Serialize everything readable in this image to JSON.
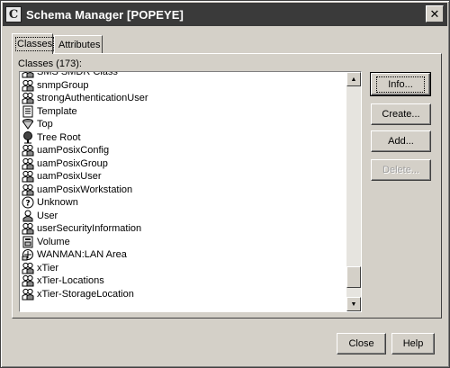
{
  "window": {
    "title": "Schema Manager [POPEYE]",
    "title_icon_glyph": "C",
    "close_glyph": "✕"
  },
  "tabs": [
    {
      "label": "Classes",
      "active": true
    },
    {
      "label": "Attributes",
      "active": false
    }
  ],
  "classes_list": {
    "caption": "Classes (173):",
    "items": [
      {
        "label": "SMS SMDR Class",
        "icon": "class-icon"
      },
      {
        "label": "snmpGroup",
        "icon": "class-icon"
      },
      {
        "label": "strongAuthenticationUser",
        "icon": "class-icon"
      },
      {
        "label": "Template",
        "icon": "template-icon"
      },
      {
        "label": "Top",
        "icon": "top-icon"
      },
      {
        "label": "Tree Root",
        "icon": "tree-root-icon"
      },
      {
        "label": "uamPosixConfig",
        "icon": "class-icon"
      },
      {
        "label": "uamPosixGroup",
        "icon": "class-icon"
      },
      {
        "label": "uamPosixUser",
        "icon": "class-icon"
      },
      {
        "label": "uamPosixWorkstation",
        "icon": "class-icon"
      },
      {
        "label": "Unknown",
        "icon": "unknown-icon"
      },
      {
        "label": "User",
        "icon": "user-icon"
      },
      {
        "label": "userSecurityInformation",
        "icon": "class-icon"
      },
      {
        "label": "Volume",
        "icon": "volume-icon"
      },
      {
        "label": "WANMAN:LAN Area",
        "icon": "lan-area-icon"
      },
      {
        "label": "xTier",
        "icon": "class-icon"
      },
      {
        "label": "xTier-Locations",
        "icon": "class-icon"
      },
      {
        "label": "xTier-StorageLocation",
        "icon": "class-icon"
      }
    ],
    "scroll_position": 0.95,
    "scroll_up_glyph": "▲",
    "scroll_down_glyph": "▼"
  },
  "actions": {
    "info": "Info...",
    "create": "Create...",
    "add": "Add...",
    "delete": "Delete..."
  },
  "footer": {
    "close": "Close",
    "help": "Help"
  }
}
